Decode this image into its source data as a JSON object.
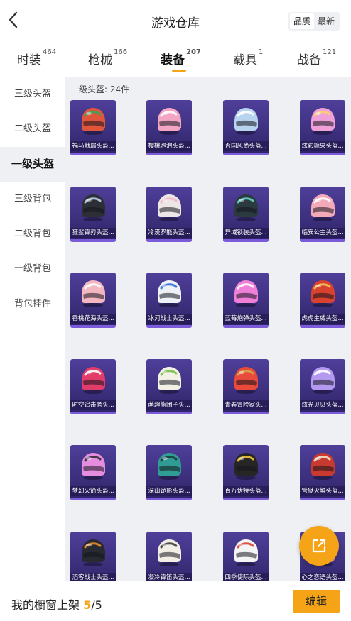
{
  "header": {
    "title": "游戏仓库",
    "sort_options": [
      "品质",
      "最新"
    ],
    "sort_selected": "品质"
  },
  "tabs": [
    {
      "label": "时装",
      "count": "464"
    },
    {
      "label": "枪械",
      "count": "166"
    },
    {
      "label": "装备",
      "count": "207",
      "active": true
    },
    {
      "label": "载具",
      "count": "1"
    },
    {
      "label": "战备",
      "count": "121"
    }
  ],
  "sidebar": {
    "items": [
      "三级头盔",
      "二级头盔",
      "一级头盔",
      "三级背包",
      "二级背包",
      "一级背包",
      "背包挂件"
    ],
    "active": "一级头盔"
  },
  "section": {
    "title": "一级头盔: 24件"
  },
  "items": [
    {
      "name": "福马献瑞头盔...",
      "color": "#e0563a",
      "accent": "#3aa55a"
    },
    {
      "name": "樱桃泡泡头盔...",
      "color": "#f2a6c4",
      "accent": "#ffffff"
    },
    {
      "name": "否国风尚头盔...",
      "color": "#b7d3ef",
      "accent": "#ffffff"
    },
    {
      "name": "炫彩糖果头盔...",
      "color": "#f0a0d8",
      "accent": "#f6d36b"
    },
    {
      "name": "狂鲨锋刃头盔...",
      "color": "#2d2f36",
      "accent": "#bcd0e6"
    },
    {
      "name": "冷漠罗能头盔...",
      "color": "#ece6e6",
      "accent": "#f3b7c7"
    },
    {
      "name": "异域锁装头盔...",
      "color": "#2b3a3f",
      "accent": "#66d0c7"
    },
    {
      "name": "临安公主头盔...",
      "color": "#f2aab9",
      "accent": "#ffffff"
    },
    {
      "name": "香桃花海头盔...",
      "color": "#f4b6c0",
      "accent": "#ffffff"
    },
    {
      "name": "冰河战士头盔...",
      "color": "#eef1f5",
      "accent": "#2f6fd6"
    },
    {
      "name": "蓝莓炮弹头盔...",
      "color": "#f07fd8",
      "accent": "#ffffff"
    },
    {
      "name": "虎虎生威头盔...",
      "color": "#d8422f",
      "accent": "#f2c45a"
    },
    {
      "name": "时空追击者头...",
      "color": "#e23c6a",
      "accent": "#ffffff"
    },
    {
      "name": "萌趣熊团子头...",
      "color": "#f3f1e6",
      "accent": "#78c04a"
    },
    {
      "name": "青春冒险家头...",
      "color": "#e84a3b",
      "accent": "#d4a649"
    },
    {
      "name": "炫光贝贝头盔...",
      "color": "#b39af0",
      "accent": "#ffffff"
    },
    {
      "name": "梦幻火箭头盔...",
      "color": "#e68de0",
      "accent": "#2f2f3a"
    },
    {
      "name": "深山诡影头盔...",
      "color": "#2f9d93",
      "accent": "#1d3d3f"
    },
    {
      "name": "百万伏特头盔...",
      "color": "#262626",
      "accent": "#f2c237"
    },
    {
      "name": "管狱火鲜头盔...",
      "color": "#c83a30",
      "accent": "#f1e4c7"
    },
    {
      "name": "滔客战士头盔...",
      "color": "#272a31",
      "accent": "#f08a2a"
    },
    {
      "name": "凝冷锋笛头盔...",
      "color": "#f2eee6",
      "accent": "#3d3d3d"
    },
    {
      "name": "四季使际头盔...",
      "color": "#f4f4f4",
      "accent": "#d8423a"
    },
    {
      "name": "心之恋语头盔...",
      "color": "#ee8ab0",
      "accent": "#ffffff"
    }
  ],
  "footer": {
    "label": "我的橱窗上架",
    "current": "5",
    "total": "/5",
    "edit_label": "编辑"
  },
  "colors": {
    "accent": "#f5a418",
    "panel_bg": "#eef0f4",
    "card_top": "#4f3f9a",
    "card_bottom": "#2d2366"
  },
  "icons": {
    "back": "chevron-left-icon",
    "share": "external-link-icon"
  }
}
